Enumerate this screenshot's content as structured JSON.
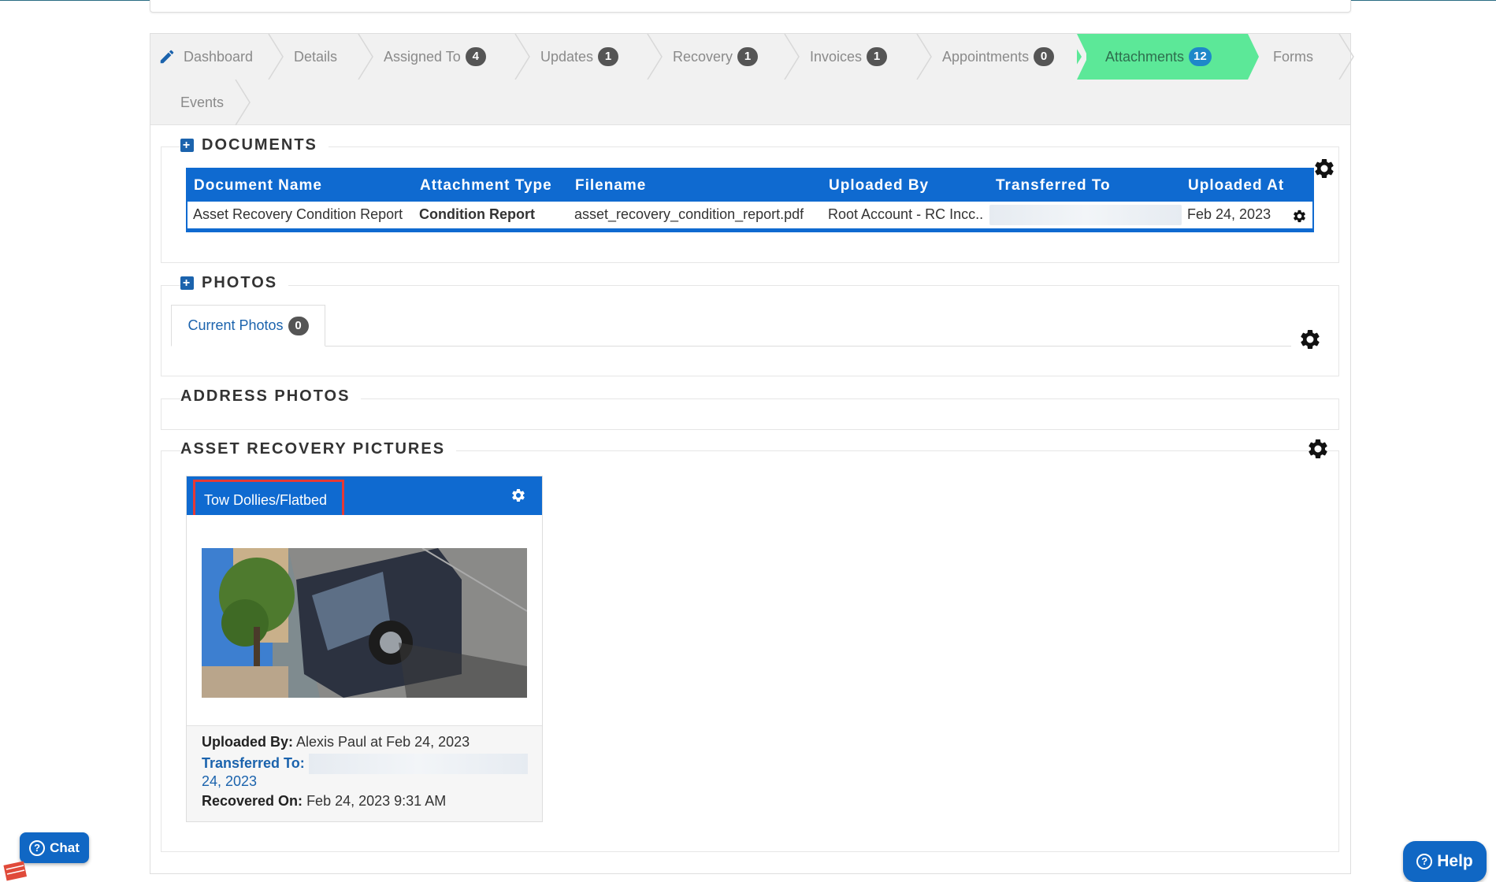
{
  "tabs": {
    "dashboard": "Dashboard",
    "details": "Details",
    "assigned_to": {
      "label": "Assigned To",
      "count": "4"
    },
    "updates": {
      "label": "Updates",
      "count": "1"
    },
    "recovery": {
      "label": "Recovery",
      "count": "1"
    },
    "invoices": {
      "label": "Invoices",
      "count": "1"
    },
    "appointments": {
      "label": "Appointments",
      "count": "0"
    },
    "attachments": {
      "label": "Attachments",
      "count": "12"
    },
    "forms": "Forms",
    "events": "Events",
    "active": "Attachments"
  },
  "documents": {
    "title": "DOCUMENTS",
    "columns": [
      "Document Name",
      "Attachment Type",
      "Filename",
      "Uploaded By",
      "Transferred To",
      "Uploaded At"
    ],
    "rows": [
      {
        "document_name": "Asset Recovery Condition Report",
        "attachment_type": "Condition Report",
        "filename": "asset_recovery_condition_report.pdf",
        "uploaded_by": "Root Account - RC Incc..",
        "uploaded_at": "Feb 24, 2023"
      }
    ]
  },
  "photos": {
    "title": "PHOTOS",
    "current_tab": {
      "label": "Current Photos",
      "count": "0"
    }
  },
  "address_photos": {
    "title": "ADDRESS PHOTOS"
  },
  "asset_recovery": {
    "title": "ASSET RECOVERY PICTURES",
    "card": {
      "title": "Tow Dollies/Flatbed",
      "uploaded_by_label": "Uploaded By:",
      "uploaded_by_value": "Alexis Paul at Feb 24, 2023",
      "transferred_to_label": "Transferred To:",
      "transferred_to_cont": "24, 2023",
      "recovered_on_label": "Recovered On:",
      "recovered_on_value": "Feb 24, 2023 9:31 AM"
    }
  },
  "widgets": {
    "chat": "Chat",
    "help": "Help"
  },
  "colors": {
    "primary": "#0f6ad0",
    "active_tab": "#5ce898",
    "highlight_box": "#e53935"
  }
}
